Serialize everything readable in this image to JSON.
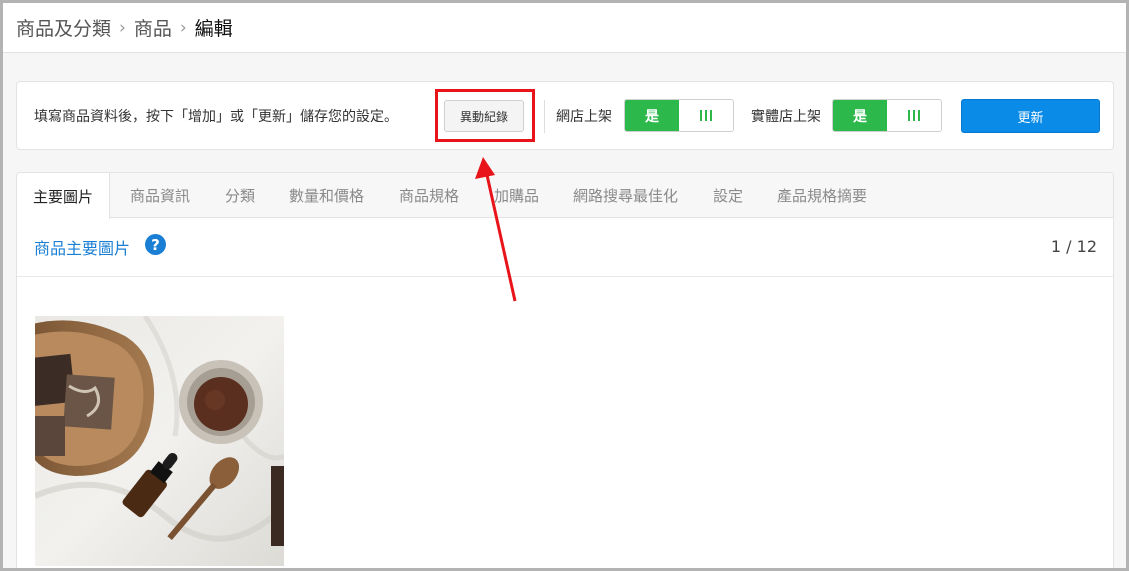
{
  "breadcrumb": {
    "items": [
      "商品及分類",
      "商品",
      "編輯"
    ],
    "separator": "›"
  },
  "action_bar": {
    "hint": "填寫商品資料後，按下「增加」或「更新」儲存您的設定。",
    "history_button": "異動紀錄",
    "online_store": {
      "label": "網店上架",
      "value": "是"
    },
    "physical_store": {
      "label": "實體店上架",
      "value": "是"
    },
    "update_button": "更新"
  },
  "tabs": [
    "主要圖片",
    "商品資訊",
    "分類",
    "數量和價格",
    "商品規格",
    "加購品",
    "網路搜尋最佳化",
    "設定",
    "產品規格摘要"
  ],
  "active_tab": "主要圖片",
  "main_image": {
    "title": "商品主要圖片",
    "help_icon": "question-circle-icon",
    "page": "1 / 12"
  },
  "colors": {
    "toggle_on": "#2db84c",
    "primary": "#0a8be8",
    "link": "#1a7fd4",
    "highlight": "#e8141a"
  }
}
